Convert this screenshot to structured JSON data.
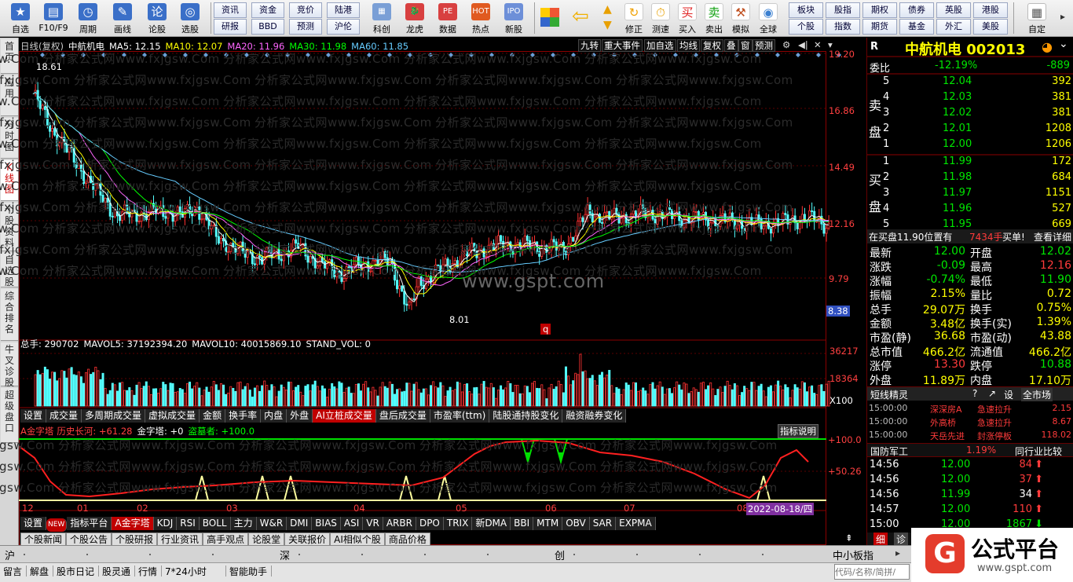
{
  "toolbar": {
    "buttons": [
      {
        "label": "自选",
        "icon": "star-icon",
        "color": "#3a6fc8"
      },
      {
        "label": "F10/F9",
        "icon": "f10-icon",
        "color": "#3a6fc8"
      },
      {
        "label": "周期",
        "icon": "clock-icon",
        "color": "#3a6fc8"
      },
      {
        "label": "画线",
        "icon": "pencil-icon",
        "color": "#3a6fc8"
      },
      {
        "label": "论股",
        "icon": "discuss-icon",
        "color": "#3a6fc8"
      },
      {
        "label": "选股",
        "icon": "select-icon",
        "color": "#3a6fc8"
      }
    ],
    "grid": [
      [
        "资讯",
        "资金",
        "竞价",
        "陆港"
      ],
      [
        "研报",
        "BBD",
        "预测",
        "沪伦"
      ]
    ],
    "buttons2": [
      {
        "label": "科创",
        "icon": "chart-icon"
      },
      {
        "label": "龙虎",
        "icon": "dragon-icon"
      },
      {
        "label": "数据",
        "icon": "pe-icon"
      },
      {
        "label": "热点",
        "icon": "hot-icon"
      },
      {
        "label": "新股",
        "icon": "ipo-icon"
      }
    ],
    "buttons3": [
      {
        "label": "修正",
        "icon": "correct-icon"
      },
      {
        "label": "测速",
        "icon": "speed-icon"
      },
      {
        "label": "买入",
        "icon": "buy-icon"
      },
      {
        "label": "卖出",
        "icon": "sell-icon"
      },
      {
        "label": "模拟",
        "icon": "hammer-icon"
      },
      {
        "label": "全球",
        "icon": "globe-icon"
      }
    ],
    "grid2": [
      [
        "板块",
        "股指",
        "期权",
        "债券",
        "英股",
        "港股"
      ],
      [
        "个股",
        "指数",
        "期货",
        "基金",
        "外汇",
        "美股"
      ]
    ],
    "custom_label": "自定"
  },
  "left_tabs": [
    "首页",
    "应用",
    "分时图",
    "K线图",
    "个股资料",
    "自选股",
    "综合排名",
    "牛叉诊股",
    "超级盘口"
  ],
  "chart": {
    "header": {
      "period": "日线(复权)",
      "stock": "中航机电",
      "ma5": "MA5: 12.15",
      "ma10": "MA10: 12.07",
      "ma20": "MA20: 11.96",
      "ma30": "MA30: 11.98",
      "ma60": "MA60: 11.85",
      "right_buttons": [
        "九转",
        "重大事件",
        "加自选",
        "均线",
        "复权",
        "叠",
        "窗",
        "预测"
      ]
    },
    "price_axis": [
      "19.20",
      "16.86",
      "14.49",
      "12.16",
      "9.79"
    ],
    "price_tag": "8.38",
    "high_label": "18.61",
    "low_label": "8.01",
    "watermark_site": "www.gspt.com",
    "watermark_text": "分析家公式网www.fxjgsw.Com",
    "vol_header": {
      "total": "总手: 290702",
      "mavol5": "MAVOL5: 37192394.20",
      "mavol10": "MAVOL10: 40015869.10",
      "stand": "STAND_VOL: 0"
    },
    "vol_axis": [
      "36217",
      "18364",
      "X100"
    ],
    "vol_tabs": [
      "设置",
      "成交量",
      "多周期成交量",
      "虚拟成交量",
      "金额",
      "换手率",
      "内盘",
      "外盘",
      "AI立桩成交量",
      "盘后成交量",
      "市盈率(ttm)",
      "陆股通持股变化",
      "融资融券变化"
    ],
    "vol_tab_active": "AI立桩成交量",
    "ind_header": {
      "name": "A金字塔",
      "hist": "历史长河: +61.28",
      "jzt": "金字塔: +0",
      "dqz": "盗墓者: +100.0",
      "explain": "指标说明"
    },
    "ind_axis": [
      "+100.0",
      "+50.26"
    ],
    "x_labels": [
      "12",
      "01",
      "02",
      "03",
      "04",
      "05",
      "06",
      "07",
      "08"
    ],
    "date_tag": "2022-08-18/四",
    "ind_tabs": [
      "设置",
      "指标平台",
      "A金字塔",
      "KDJ",
      "RSI",
      "BOLL",
      "主力",
      "W&R",
      "DMI",
      "BIAS",
      "ASI",
      "VR",
      "ARBR",
      "DPO",
      "TRIX",
      "新DMA",
      "BBI",
      "MTM",
      "OBV",
      "SAR",
      "EXPMA"
    ],
    "ind_tab_active": "A金字塔",
    "new_badge": "NEW",
    "news_tabs": [
      "个股新闻",
      "个股公告",
      "个股研报",
      "行业资讯",
      "高手观点",
      "论股堂",
      "关联报价",
      "AI相似个股",
      "商品价格"
    ]
  },
  "right": {
    "code_label": "R",
    "title": "中航机电 002013",
    "weibi_label": "委比",
    "weibi": "-12.19%",
    "weicha": "-889",
    "sell_label": "卖盘",
    "buy_label": "买盘",
    "sells": [
      [
        "5",
        "12.04",
        "392"
      ],
      [
        "4",
        "12.03",
        "381"
      ],
      [
        "3",
        "12.02",
        "381"
      ],
      [
        "2",
        "12.01",
        "1208"
      ],
      [
        "1",
        "12.00",
        "1206"
      ]
    ],
    "buys": [
      [
        "1",
        "11.99",
        "172"
      ],
      [
        "2",
        "11.98",
        "684"
      ],
      [
        "3",
        "11.97",
        "1151"
      ],
      [
        "4",
        "11.96",
        "527"
      ],
      [
        "5",
        "11.95",
        "669"
      ]
    ],
    "buy_info": "在买盘11.90位置有",
    "buy_qty": "7434手",
    "buy_tag": "买单!",
    "detail": "查看详细",
    "stats": [
      [
        "最新",
        "12.00",
        "开盘",
        "12.02"
      ],
      [
        "涨跌",
        "-0.09",
        "最高",
        "12.16"
      ],
      [
        "涨幅",
        "-0.74%",
        "最低",
        "11.90"
      ],
      [
        "振幅",
        "2.15%",
        "量比",
        "0.72"
      ],
      [
        "总手",
        "29.07万",
        "换手",
        "0.75%"
      ],
      [
        "金额",
        "3.48亿",
        "换手(实)",
        "1.39%"
      ],
      [
        "市盈(静)",
        "36.68",
        "市盈(动)",
        "43.88"
      ],
      [
        "总市值",
        "466.2亿",
        "流通值",
        "466.2亿"
      ],
      [
        "涨停",
        "13.30",
        "跌停",
        "10.88"
      ],
      [
        "外盘",
        "11.89万",
        "内盘",
        "17.10万"
      ]
    ],
    "short_title": "短线精灵",
    "market_label": "全市场",
    "short_rows": [
      [
        "15:00:00",
        "深深房A",
        "急速拉升",
        "2.15"
      ],
      [
        "15:00:00",
        "外高桥",
        "急速拉升",
        "8.67"
      ],
      [
        "15:00:00",
        "天岳先进",
        "封涨停板",
        "118.02"
      ]
    ],
    "industry": "国防军工",
    "industry_pct": "1.19%",
    "industry_cmp": "同行业比较",
    "ticks": [
      [
        "14:56",
        "12.00",
        "84",
        "up"
      ],
      [
        "14:56",
        "12.00",
        "37",
        "up"
      ],
      [
        "14:56",
        "11.99",
        "34",
        "up"
      ],
      [
        "14:57",
        "12.00",
        "110",
        "up"
      ],
      [
        "15:00",
        "12.00",
        "1867",
        "down"
      ]
    ],
    "tab_fine": "细",
    "tab_diag": "诊"
  },
  "statusbar": {
    "markets": [
      "沪",
      "深",
      "创",
      "中小板指"
    ],
    "items": [
      "留言",
      "解盘",
      "股市日记",
      "股灵通",
      "行情",
      "7*24小时",
      "智能助手"
    ],
    "search_placeholder": "代码/名称/简拼/",
    "brand": "公式平台",
    "brand_url": "www.gspt.com"
  }
}
